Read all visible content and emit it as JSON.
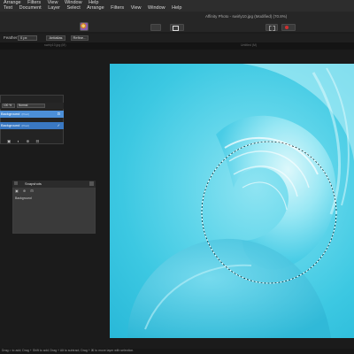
{
  "menu_row1": [
    "Arrange",
    "Filters",
    "View",
    "Window",
    "Help"
  ],
  "menu_row2": [
    "Text",
    "Document",
    "Layer",
    "Select",
    "Arrange",
    "Filters",
    "View",
    "Window",
    "Help"
  ],
  "window_title": "Affinity Photo - swirly10.jpg (Modified) (70.8%)",
  "context": {
    "feather_label": "Feather:",
    "feather_value": "0 px",
    "antialias_label": "Antialias",
    "refine_label": "Refine..."
  },
  "tabs": [
    "swirly10.jpg (M)",
    "Untitled (M)"
  ],
  "layers": {
    "opacity": "100 %",
    "blend": "Normal",
    "rows": [
      {
        "name": "Background",
        "kind": "(Pixel)"
      },
      {
        "name": "Background",
        "kind": "(Pixel)"
      }
    ],
    "footer_icons": "▣ ◐ ⊕ ⊟"
  },
  "snapshots": {
    "title": "Snapshots",
    "tools": "▣ ⊕ ⊟",
    "item": "Background"
  },
  "status": "Drag = to add; Drag + Shift to add; Drag + Alt to subtract; Drag + ⌘ to move layer with selection.",
  "colors": {
    "accent_selected_layer": "#4c8fd8",
    "canvas_base": "#3cc8e2"
  }
}
